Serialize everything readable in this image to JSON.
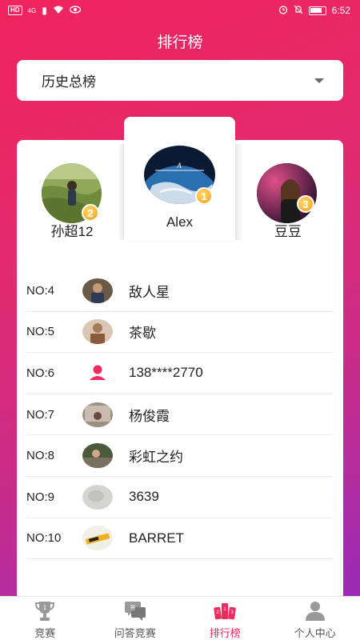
{
  "status_bar": {
    "hd": "HD",
    "network": "4G",
    "time": "6:52"
  },
  "header": {
    "title": "排行榜"
  },
  "filter": {
    "selected": "历史总榜"
  },
  "podium": [
    {
      "rank": "2",
      "name": "孙超12"
    },
    {
      "rank": "1",
      "name": "Alex"
    },
    {
      "rank": "3",
      "name": "豆豆"
    }
  ],
  "ranking": [
    {
      "rank": "NO:4",
      "name": "敌人星"
    },
    {
      "rank": "NO:5",
      "name": "茶歇"
    },
    {
      "rank": "NO:6",
      "name": "138****2770"
    },
    {
      "rank": "NO:7",
      "name": "杨俊霞"
    },
    {
      "rank": "NO:8",
      "name": "彩虹之约"
    },
    {
      "rank": "NO:9",
      "name": "3639"
    },
    {
      "rank": "NO:10",
      "name": "BARRET"
    }
  ],
  "tabs": [
    {
      "label": "竞赛",
      "icon": "trophy-icon"
    },
    {
      "label": "问答竞赛",
      "icon": "qa-chat-icon"
    },
    {
      "label": "排行榜",
      "icon": "ranking-cards-icon",
      "active": true
    },
    {
      "label": "个人中心",
      "icon": "user-icon"
    }
  ],
  "colors": {
    "accent": "#ee2a5e",
    "gradient_start": "#f0245e",
    "gradient_end": "#9a2bb7",
    "badge": "#f0a020"
  }
}
